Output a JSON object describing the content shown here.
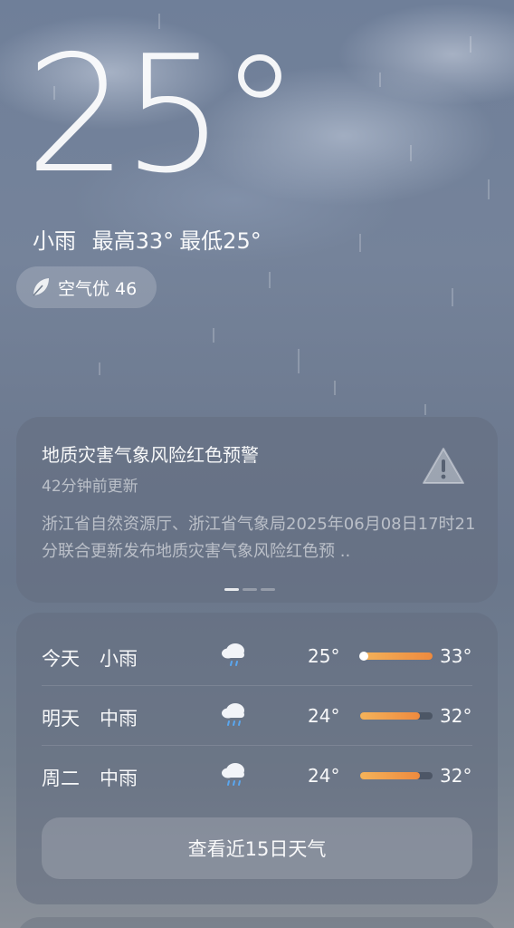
{
  "current": {
    "temperature": "25°",
    "condition": "小雨",
    "high_label": "最高33°",
    "low_label": "最低25°"
  },
  "aqi": {
    "icon": "leaf-icon",
    "label": "空气优 46"
  },
  "alert": {
    "title": "地质灾害气象风险红色预警",
    "updated": "42分钟前更新",
    "body": "浙江省自然资源厅、浙江省气象局2025年06月08日17时21分联合更新发布地质灾害气象风险红色预 ..",
    "icon": "warning-triangle-icon",
    "pages": 3,
    "active_page": 0
  },
  "forecast": {
    "days": [
      {
        "day": "今天",
        "condition": "小雨",
        "icon": "light-rain-cloud-icon",
        "low": "25°",
        "high": "33°",
        "bar_start": 0.0,
        "bar_end": 1.0,
        "current_marker": 0.0
      },
      {
        "day": "明天",
        "condition": "中雨",
        "icon": "moderate-rain-cloud-icon",
        "low": "24°",
        "high": "32°",
        "bar_start": 0.0,
        "bar_end": 0.82,
        "current_marker": null
      },
      {
        "day": "周二",
        "condition": "中雨",
        "icon": "moderate-rain-cloud-icon",
        "low": "24°",
        "high": "32°",
        "bar_start": 0.0,
        "bar_end": 0.82,
        "current_marker": null
      }
    ],
    "more_button": "查看近15日天气"
  },
  "colors": {
    "bar_fill_start": "#f4b35a",
    "bar_fill_end": "#ee8a3e"
  }
}
